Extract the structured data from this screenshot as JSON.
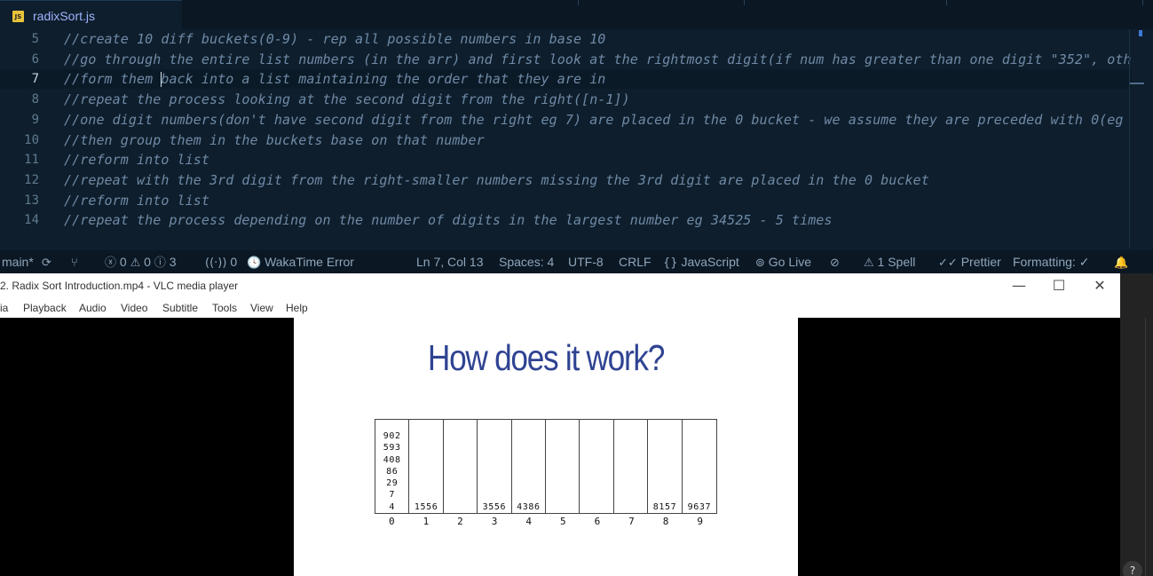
{
  "editor": {
    "tab": {
      "badge": "JS",
      "title": "radixSort.js"
    },
    "lines": [
      {
        "num": "5",
        "text": "//create 10 diff buckets(0-9) - rep all possible numbers in base 10"
      },
      {
        "num": "6",
        "text": "//go through the entire list numbers (in the arr) and first look at the rightmost digit(if num has greater than one digit \"352\", oth"
      },
      {
        "num": "7",
        "text": "//form them back into a list maintaining the order that they are in"
      },
      {
        "num": "8",
        "text": "//repeat the process looking at the second digit from the right([n-1])"
      },
      {
        "num": "9",
        "text": "//one digit numbers(don't have second digit from the right eg 7) are placed in the 0 bucket - we assume they are preceded with 0(eg"
      },
      {
        "num": "10",
        "text": "//then group them in the buckets base on that number"
      },
      {
        "num": "11",
        "text": "//reform into list"
      },
      {
        "num": "12",
        "text": "//repeat with the 3rd digit from the right-smaller numbers missing the 3rd digit are placed in the 0 bucket"
      },
      {
        "num": "13",
        "text": "//reform into list"
      },
      {
        "num": "14",
        "text": "//repeat the process depending on the number of digits in the largest number eg 34525 - 5 times"
      }
    ]
  },
  "statusbar": {
    "branch": "main*",
    "sync_icon": "⟳",
    "git_graph_icon": "⑂",
    "errors": "0",
    "warnings": "0",
    "infos": "3",
    "ports": "0",
    "wakatime": "WakaTime Error",
    "position": "Ln 7, Col 13",
    "spaces": "Spaces: 4",
    "encoding": "UTF-8",
    "eol": "CRLF",
    "language": "JavaScript",
    "golive": "Go Live",
    "spell": "1 Spell",
    "prettier": "Prettier",
    "formatting": "Formatting: ✓",
    "bell_icon": "🔔"
  },
  "vlc": {
    "title": "2. Radix Sort Introduction.mp4 - VLC media player",
    "menu": [
      "ia",
      "Playback",
      "Audio",
      "Video",
      "Subtitle",
      "Tools",
      "View",
      "Help"
    ],
    "minimize": "—",
    "maximize": "☐",
    "close": "✕"
  },
  "slide": {
    "title": "How does it work?",
    "buckets": [
      {
        "label": "0",
        "items": [
          "902",
          "593",
          "408",
          "86",
          "29",
          "7",
          "4"
        ]
      },
      {
        "label": "1",
        "items": [
          "1556"
        ]
      },
      {
        "label": "2",
        "items": []
      },
      {
        "label": "3",
        "items": [
          "3556"
        ]
      },
      {
        "label": "4",
        "items": [
          "4386"
        ]
      },
      {
        "label": "5",
        "items": []
      },
      {
        "label": "6",
        "items": []
      },
      {
        "label": "7",
        "items": []
      },
      {
        "label": "8",
        "items": [
          "8157"
        ]
      },
      {
        "label": "9",
        "items": [
          "9637"
        ]
      }
    ]
  },
  "help": "?"
}
